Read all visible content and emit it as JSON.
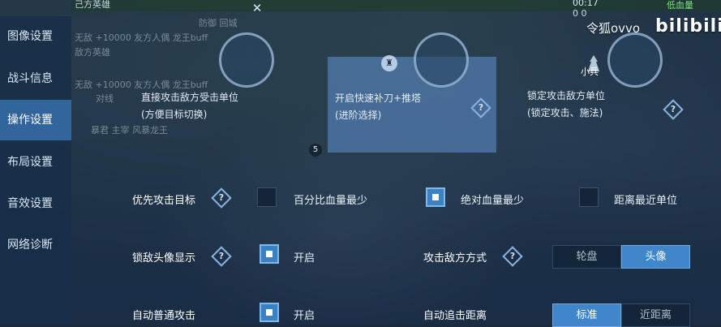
{
  "hud": {
    "ally_label": "己方英雄",
    "timer": "00:17",
    "timer_sub": "0   0",
    "low_hp": "低血量",
    "close_glyph": "✕"
  },
  "watermark": {
    "author": "令狐ovvo",
    "logo": "bilibili"
  },
  "sidebar": {
    "items": [
      {
        "label": "图像设置",
        "active": false
      },
      {
        "label": "战斗信息",
        "active": false
      },
      {
        "label": "操作设置",
        "active": true
      },
      {
        "label": "布局设置",
        "active": false
      },
      {
        "label": "音效设置",
        "active": false
      },
      {
        "label": "网络诊断",
        "active": false
      }
    ]
  },
  "ghost_panel": {
    "row1": "防御   回城",
    "row2": "无敌   +10000   友方人偶   龙王buff",
    "row3": "敌方英雄",
    "row4": "无敌   +10000   友方人偶   龙王buff",
    "row5": "对线",
    "row6": "暴君   主宰   风暴龙王"
  },
  "target_modes": [
    {
      "text": "直接攻击敌方受击单位\n(方便目标切换)",
      "selected": false
    },
    {
      "text": "开启快速补刀+推塔\n(进阶选择)",
      "selected": true
    },
    {
      "text": "锁定攻击敌方单位\n(锁定攻击、施法)",
      "selected": false
    }
  ],
  "minion_label": "小兵",
  "helmet_glyph": "♜",
  "marker_number": "5",
  "help_glyph": "?",
  "priority": {
    "label": "优先攻击目标",
    "options": [
      {
        "label": "百分比血量最少",
        "checked": false
      },
      {
        "label": "绝对血量最少",
        "checked": true
      },
      {
        "label": "距离最近单位",
        "checked": false
      }
    ]
  },
  "lock_avatar": {
    "label": "锁敌头像显示",
    "option": {
      "label": "开启",
      "checked": true
    }
  },
  "attack_method": {
    "label": "攻击敌方方式",
    "options": [
      "轮盘",
      "头像"
    ],
    "selected": "头像"
  },
  "auto_attack": {
    "label": "自动普通攻击",
    "option": {
      "label": "开启",
      "checked": true
    }
  },
  "chase_distance": {
    "label": "自动追击距离",
    "options": [
      "标准",
      "近距离"
    ],
    "selected": "标准"
  },
  "colors": {
    "accent": "#3f86cb",
    "sidebar_active": "#376eaa",
    "checkbox_on": "#3a82c4"
  }
}
